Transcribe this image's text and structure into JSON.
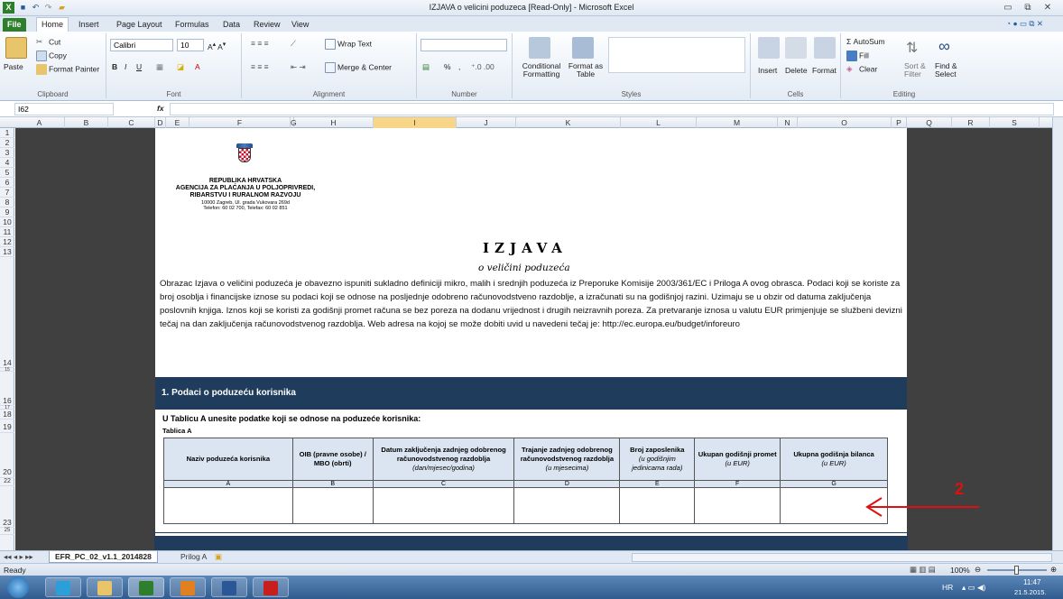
{
  "window": {
    "title": "IZJAVA o velicini poduzeca  [Read-Only]  -  Microsoft Excel"
  },
  "tabs": [
    "File",
    "Home",
    "Insert",
    "Page Layout",
    "Formulas",
    "Data",
    "Review",
    "View"
  ],
  "ribbon": {
    "clipboard": {
      "label": "Clipboard",
      "paste": "Paste",
      "cut": "Cut",
      "copy": "Copy",
      "format_painter": "Format Painter"
    },
    "font": {
      "label": "Font",
      "name": "Calibri",
      "size": "10"
    },
    "alignment": {
      "label": "Alignment",
      "wrap": "Wrap Text",
      "merge": "Merge & Center"
    },
    "number": {
      "label": "Number",
      "percent": "%"
    },
    "styles": {
      "label": "Styles",
      "conditional": "Conditional Formatting",
      "format_table": "Format as Table"
    },
    "cells": {
      "label": "Cells",
      "insert": "Insert",
      "delete": "Delete",
      "format": "Format"
    },
    "editing": {
      "label": "Editing",
      "autosum": "AutoSum",
      "fill": "Fill",
      "clear": "Clear",
      "sort": "Sort & Filter",
      "find": "Find & Select"
    }
  },
  "formula_bar": {
    "name_box": "I62",
    "fx": "fx",
    "formula": ""
  },
  "columns": [
    "A",
    "B",
    "C",
    "D",
    "E",
    "F",
    "G",
    "H",
    "I",
    "J",
    "K",
    "L",
    "M",
    "N",
    "O",
    "P",
    "Q",
    "R",
    "S"
  ],
  "rows": [
    "1",
    "2",
    "3",
    "4",
    "5",
    "6",
    "7",
    "8",
    "9",
    "10",
    "11",
    "12",
    "13",
    "14",
    "15",
    "16",
    "17",
    "18",
    "19",
    "20",
    "22",
    "23",
    "25"
  ],
  "doc": {
    "org_line1": "REPUBLIKA HRVATSKA",
    "org_line2": "AGENCIJA ZA PLAĆANJA U POLJOPRIVREDI,",
    "org_line3": "RIBARSTVU I RURALNOM RAZVOJU",
    "org_addr": "10000 Zagreb, Ul. grada Vukovara 269d",
    "org_phone": "Telefon: 60 02 700, Telefax: 60 02 851",
    "title": "IZJAVA",
    "subtitle": "o veličini poduzeća",
    "intro": "Obrazac Izjava o veličini poduzeća je obavezno ispuniti sukladno definiciji mikro, malih i srednjih poduzeća iz Preporuke Komisije 2003/361/EC i Priloga A ovog obrasca. Podaci koji se koriste za broj osoblja i financijske iznose su podaci koji se odnose na posljednje odobreno računovodstveno razdoblje, a izračunati su na godišnjoj razini. Uzimaju se u obzir od datuma zaključenja poslovnih knjiga. Iznos koji se koristi za godišnji promet računa se bez poreza na dodanu vrijednost i drugih neizravnih poreza. Za pretvaranje iznosa u valutu EUR primjenjuje se službeni devizni tečaj na dan zaključenja računovodstvenog razdoblja. Web adresa na kojoj se može dobiti uvid u navedeni tečaj je: http://ec.europa.eu/budget/inforeuro",
    "section1": "1. Podaci o poduzeću korisnika",
    "instruction": "U Tablicu A unesite podatke koji se odnose na poduzeće korisnika:",
    "table_label": "Tablica A",
    "table_headers": [
      {
        "main": "Naziv poduzeća korisnika",
        "sub": ""
      },
      {
        "main": "OIB (pravne osobe) / MBO (obrti)",
        "sub": ""
      },
      {
        "main": "Datum zaključenja zadnjeg odobrenog računovodstvenog razdoblja",
        "sub": "(dan/mjesec/godina)"
      },
      {
        "main": "Trajanje zadnjeg odobrenog računovodstvenog razdoblja",
        "sub": "(u mjesecima)"
      },
      {
        "main": "Broj zaposlenika",
        "sub": "(u godišnjim jedinicama rada)"
      },
      {
        "main": "Ukupan godišnji promet",
        "sub": "(u EUR)"
      },
      {
        "main": "Ukupna godišnja bilanca",
        "sub": "(u EUR)"
      }
    ],
    "table_letters": [
      "A",
      "B",
      "C",
      "D",
      "E",
      "F",
      "G"
    ],
    "annotation": "2"
  },
  "sheet_tabs": [
    "EFR_PC_02_v1.1_2014828",
    "Prilog A"
  ],
  "status": {
    "ready": "Ready",
    "zoom": "100%"
  },
  "taskbar": {
    "lang": "HR",
    "time": "11:47",
    "date": "21.5.2015."
  },
  "colors": {
    "band": "#1f3c5c",
    "annotation": "#e01010",
    "file_tab": "#2d7f2d"
  }
}
